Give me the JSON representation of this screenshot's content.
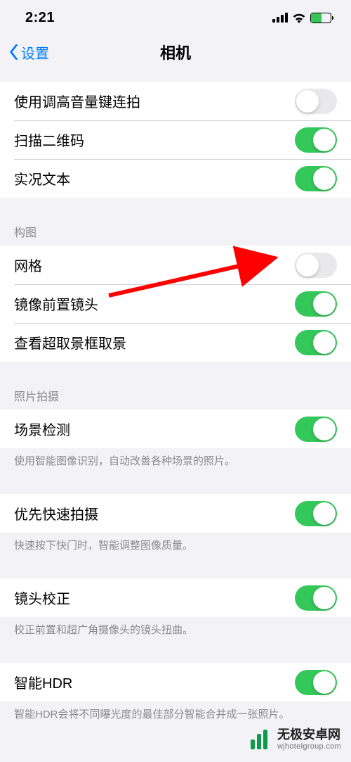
{
  "status": {
    "time": "2:21"
  },
  "nav": {
    "back": "设置",
    "title": "相机"
  },
  "groups": {
    "top": {
      "items": [
        {
          "label": "使用调高音量键连拍",
          "on": false
        },
        {
          "label": "扫描二维码",
          "on": true
        },
        {
          "label": "实况文本",
          "on": true
        }
      ]
    },
    "composition": {
      "header": "构图",
      "items": [
        {
          "label": "网格",
          "on": false
        },
        {
          "label": "镜像前置镜头",
          "on": true
        },
        {
          "label": "查看超取景框取景",
          "on": true
        }
      ]
    },
    "photo": {
      "header": "照片拍摄",
      "sections": [
        {
          "label": "场景检测",
          "on": true,
          "footer": "使用智能图像识别，自动改善各种场景的照片。"
        },
        {
          "label": "优先快速拍摄",
          "on": true,
          "footer": "快速按下快门时，智能调整图像质量。"
        },
        {
          "label": "镜头校正",
          "on": true,
          "footer": "校正前置和超广角摄像头的镜头扭曲。"
        },
        {
          "label": "智能HDR",
          "on": true,
          "footer": "智能HDR会将不同曝光度的最佳部分智能合并成一张照片。"
        }
      ]
    }
  },
  "watermark": {
    "title": "无极安卓网",
    "url": "wjhotelgroup.com"
  }
}
